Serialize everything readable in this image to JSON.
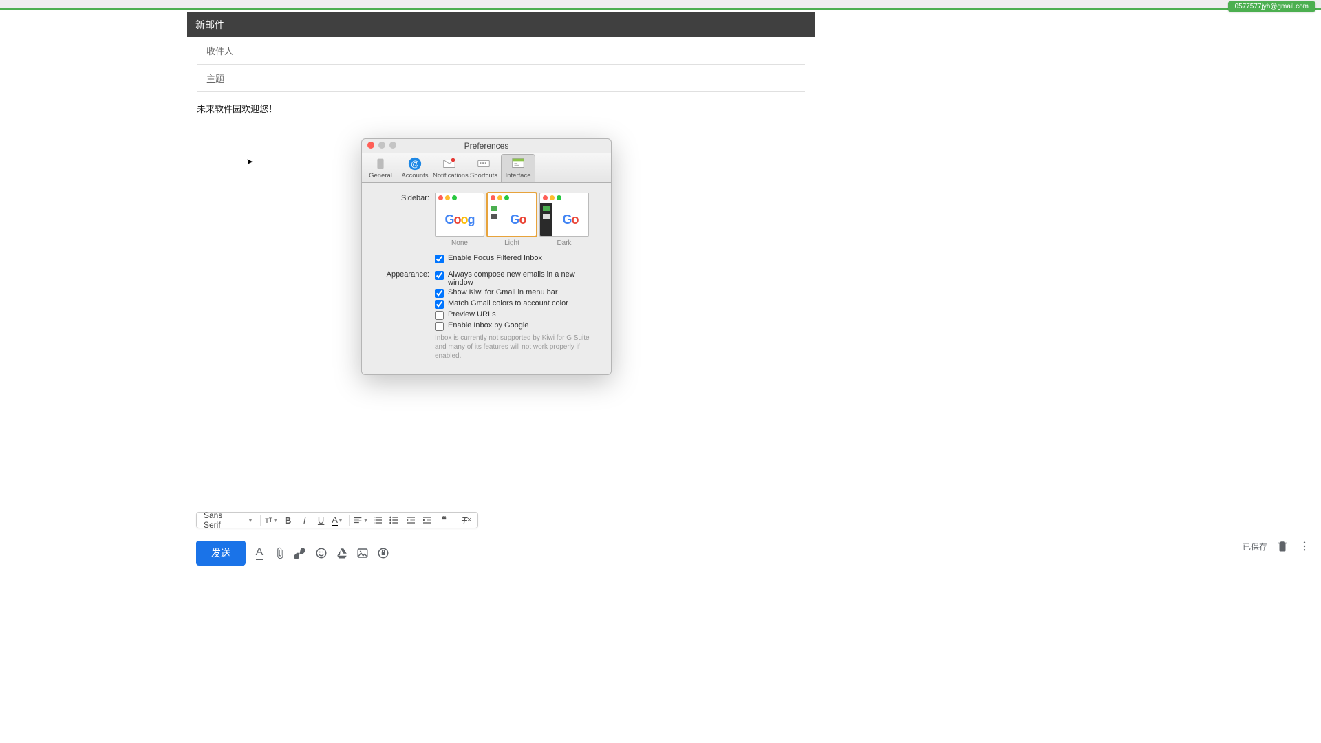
{
  "account_email": "0577577jyh@gmail.com",
  "compose": {
    "title": "新邮件",
    "to_placeholder": "收件人",
    "subject_placeholder": "主题",
    "body_text": "未来软件园欢迎您！"
  },
  "format": {
    "font_label": "Sans Serif"
  },
  "bottom": {
    "send_label": "发送",
    "saved_label": "已保存"
  },
  "prefs": {
    "title": "Preferences",
    "tabs": {
      "general": "General",
      "accounts": "Accounts",
      "notifications": "Notifications",
      "shortcuts": "Shortcuts",
      "interface": "Interface"
    },
    "sidebar_label": "Sidebar:",
    "appearance_label": "Appearance:",
    "sidebar_options": {
      "none": "None",
      "light": "Light",
      "dark": "Dark"
    },
    "checkboxes": {
      "enable_focus": "Enable Focus Filtered Inbox",
      "always_new_window": "Always compose new emails in a new window",
      "show_menubar": "Show Kiwi for Gmail in menu bar",
      "match_colors": "Match Gmail colors to account color",
      "preview_urls": "Preview URLs",
      "enable_inbox": "Enable Inbox by Google"
    },
    "helper_text": "Inbox is currently not supported by Kiwi for G Suite and many of its features will not work properly if enabled."
  }
}
